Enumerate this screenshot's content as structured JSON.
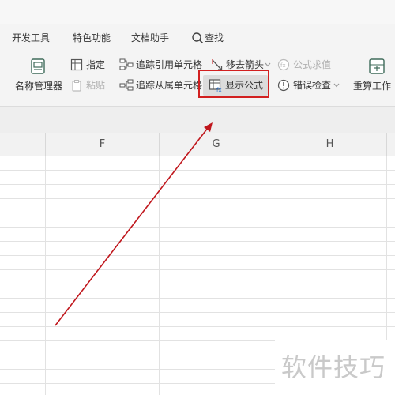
{
  "tabs": {
    "dev_tools": "开发工具",
    "special_features": "特色功能",
    "doc_assistant": "文档助手",
    "search": "查找"
  },
  "ribbon": {
    "name_manager": "名称管理器",
    "specify": "指定",
    "paste": "粘贴",
    "trace_precedents": "追踪引用单元格",
    "trace_dependents": "追踪从属单元格",
    "remove_arrows": "移去箭头",
    "show_formulas": "显示公式",
    "evaluate_formula": "公式求值",
    "error_checking": "错误检查",
    "recalculate": "重算工作"
  },
  "columns": [
    "F",
    "G",
    "H"
  ],
  "watermark": "软件技巧",
  "colors": {
    "highlight_border": "#d22020",
    "arrow": "#c0161c",
    "ribbon_bg": "#f4f4f4"
  }
}
